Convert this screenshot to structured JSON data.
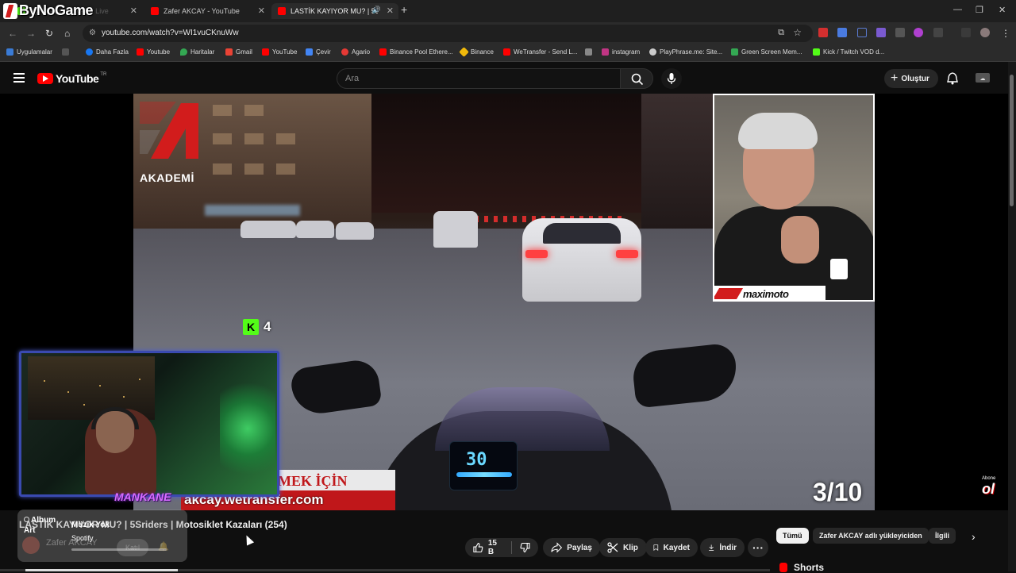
{
  "branding": {
    "overlay_logo": "ByNoGame"
  },
  "tabs": [
    {
      "label": "ByNoGame - Watch Live",
      "active": false
    },
    {
      "label": "Zafer AKCAY - YouTube",
      "active": false
    },
    {
      "label": "LASTİK KAYIYOR MU? | 5S...",
      "active": true
    }
  ],
  "address": {
    "url": "youtube.com/watch?v=WI1vuCKnuWw"
  },
  "bookmarks": [
    {
      "label": "Uygulamalar",
      "color": "#3a7bd5"
    },
    {
      "label": "Daha Fazla",
      "color": "#1877f2"
    },
    {
      "label": "Youtube",
      "color": "#ff0000"
    },
    {
      "label": "Haritalar",
      "color": "#34a853"
    },
    {
      "label": "Gmail",
      "color": "#ea4335"
    },
    {
      "label": "YouTube",
      "color": "#ff0000"
    },
    {
      "label": "Çevir",
      "color": "#4285f4"
    },
    {
      "label": "Agario",
      "color": "#e53935"
    },
    {
      "label": "Binance Pool Ethere...",
      "color": "#ff0000"
    },
    {
      "label": "Binance",
      "color": "#f0b90b"
    },
    {
      "label": "WeTransfer - Send L...",
      "color": "#ff0000"
    },
    {
      "label": "instagram",
      "color": "#c13584"
    },
    {
      "label": "PlayPhrase.me: Site...",
      "color": "#cccccc"
    },
    {
      "label": "Green Screen Mem...",
      "color": "#34a853"
    },
    {
      "label": "Kick / Twitch VOD d...",
      "color": "#53fc18"
    }
  ],
  "youtube": {
    "logo_text": "YouTube",
    "region": "TR",
    "search_placeholder": "Ara",
    "create_label": "Oluştur"
  },
  "video": {
    "akademi_label": "AKADEMİ",
    "inset_brand": "maximoto",
    "kick_count": "4",
    "overlay_line1": "MEK İÇİN",
    "overlay_line2": "akcay.wetransfer.com",
    "webcam_caption": "MANKANE",
    "counter": "3/10",
    "speed": "30",
    "subscribe_badge_top": "Abone",
    "subscribe_badge": "ol"
  },
  "details": {
    "title": "LASTİK KAYIYOR MU? | 5Sriders | Motosiklet Kazaları (254)",
    "channel": "Zafer AKCAY",
    "join_label": "Katıl",
    "like_count": "15 B",
    "share_label": "Paylaş",
    "clip_label": "Klip",
    "save_label": "Kaydet",
    "download_label": "İndir"
  },
  "spotify_widget": {
    "album_art_text": "Album Art",
    "title": "Müzik Yok",
    "subtitle": "Spotify"
  },
  "chips": [
    {
      "label": "Tümü",
      "active": true
    },
    {
      "label": "Zafer AKCAY adlı yükleyiciden",
      "active": false
    },
    {
      "label": "İlgili",
      "active": false
    }
  ],
  "sidebar": {
    "shorts_label": "Shorts"
  }
}
